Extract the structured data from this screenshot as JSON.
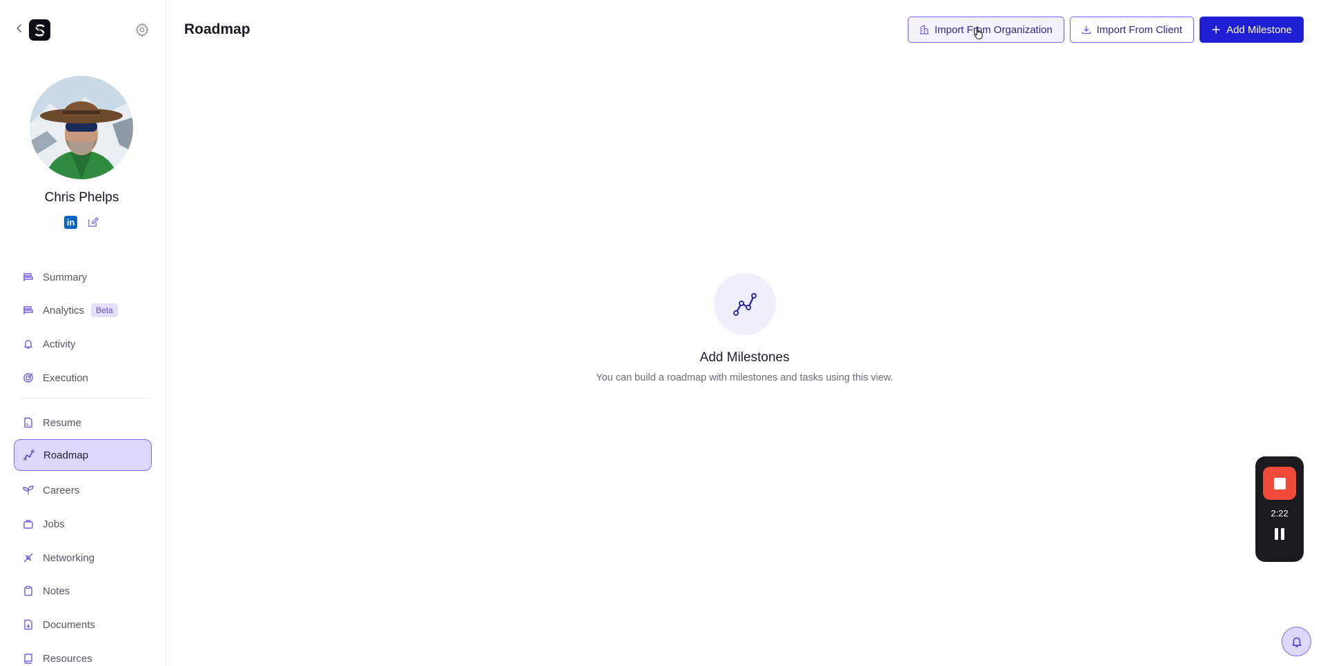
{
  "sidebar": {
    "profile": {
      "name": "Chris Phelps"
    },
    "nav": [
      {
        "id": "summary",
        "label": "Summary",
        "icon": "summary-icon"
      },
      {
        "id": "analytics",
        "label": "Analytics",
        "icon": "analytics-icon",
        "badge": "Beta"
      },
      {
        "id": "activity",
        "label": "Activity",
        "icon": "bell-icon"
      },
      {
        "id": "execution",
        "label": "Execution",
        "icon": "target-icon"
      },
      {
        "id": "resume",
        "label": "Resume",
        "icon": "resume-icon"
      },
      {
        "id": "roadmap",
        "label": "Roadmap",
        "icon": "roadmap-icon",
        "active": true
      },
      {
        "id": "careers",
        "label": "Careers",
        "icon": "sprout-icon"
      },
      {
        "id": "jobs",
        "label": "Jobs",
        "icon": "briefcase-icon"
      },
      {
        "id": "networking",
        "label": "Networking",
        "icon": "network-icon"
      },
      {
        "id": "notes",
        "label": "Notes",
        "icon": "clipboard-icon"
      },
      {
        "id": "documents",
        "label": "Documents",
        "icon": "document-icon"
      },
      {
        "id": "resources",
        "label": "Resources",
        "icon": "book-icon"
      }
    ]
  },
  "header": {
    "title": "Roadmap",
    "actions": {
      "import_org": "Import From Organization",
      "import_client": "Import From Client",
      "add_milestone": "Add Milestone"
    }
  },
  "empty_state": {
    "title": "Add Milestones",
    "subtitle": "You can build a roadmap with milestones and tasks using this view."
  },
  "recorder": {
    "time": "2:22"
  },
  "colors": {
    "accent": "#1f1fd6",
    "accent_soft": "#ddd7fb",
    "accent_border": "#7c6cf0",
    "record_red": "#f04a3a",
    "linkedin": "#0a66c2"
  }
}
